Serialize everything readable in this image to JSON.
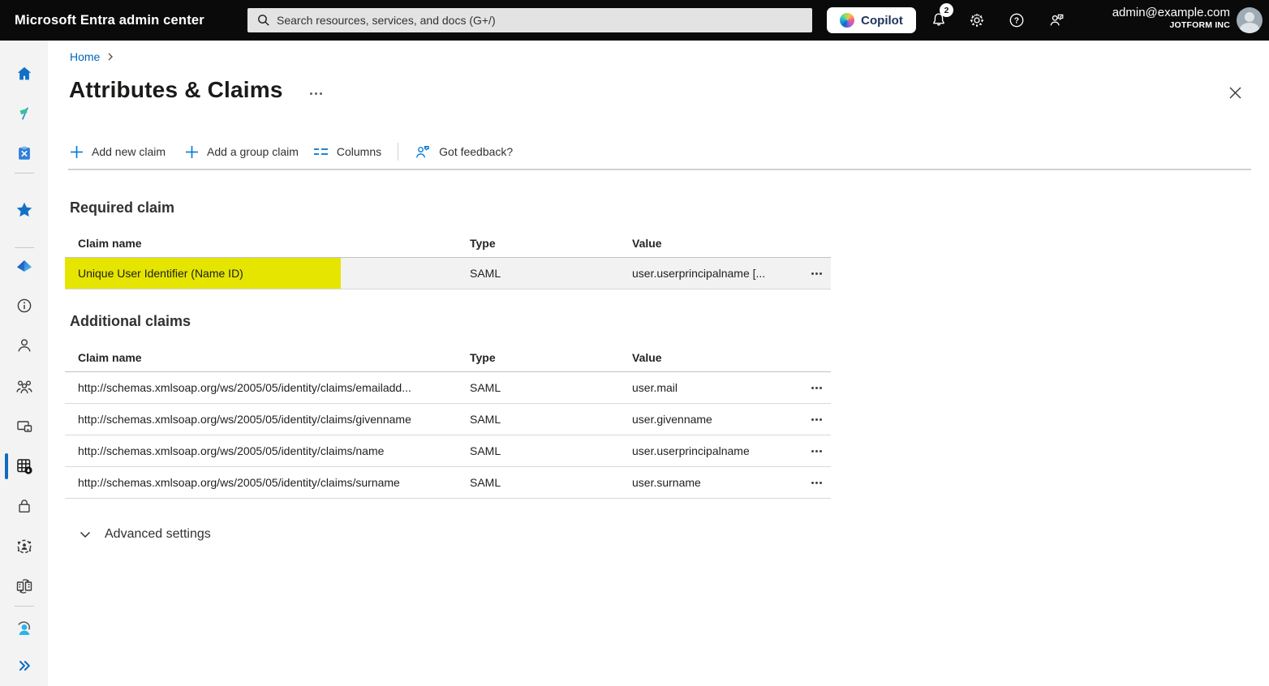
{
  "topbar": {
    "brand": "Microsoft Entra admin center",
    "search_placeholder": "Search resources, services, and docs (G+/)",
    "copilot_label": "Copilot",
    "notification_count": "2",
    "account_email": "admin@example.com",
    "account_org": "JOTFORM INC",
    "icons": [
      "bell-icon",
      "gear-icon",
      "help-icon",
      "feedback-icon",
      "avatar"
    ]
  },
  "sidebar": {
    "icons": [
      "home-icon",
      "whats-new-flag-icon",
      "diagnose-solve-icon",
      "favorites-star-icon",
      "entra-id-icon",
      "info-icon",
      "users-icon",
      "groups-icon",
      "devices-icon",
      "applications-grid-icon",
      "protection-lock-icon",
      "identity-governance-icon",
      "external-identities-icon",
      "learn-support-icon",
      "expand-chevrons-icon"
    ],
    "active_icon": "applications-grid-icon"
  },
  "breadcrumb": {
    "home": "Home"
  },
  "page": {
    "title": "Attributes & Claims"
  },
  "toolbar": {
    "add_new_claim": "Add new claim",
    "add_group_claim": "Add a group claim",
    "columns": "Columns",
    "got_feedback": "Got feedback?"
  },
  "required_claim": {
    "heading": "Required claim",
    "columns": {
      "claim_name": "Claim name",
      "type": "Type",
      "value": "Value"
    },
    "rows": [
      {
        "claim_name": "Unique User Identifier (Name ID)",
        "type": "SAML",
        "value": "user.userprincipalname [...",
        "highlighted": true
      }
    ]
  },
  "additional_claims": {
    "heading": "Additional claims",
    "columns": {
      "claim_name": "Claim name",
      "type": "Type",
      "value": "Value"
    },
    "rows": [
      {
        "claim_name": "http://schemas.xmlsoap.org/ws/2005/05/identity/claims/emailadd...",
        "type": "SAML",
        "value": "user.mail"
      },
      {
        "claim_name": "http://schemas.xmlsoap.org/ws/2005/05/identity/claims/givenname",
        "type": "SAML",
        "value": "user.givenname"
      },
      {
        "claim_name": "http://schemas.xmlsoap.org/ws/2005/05/identity/claims/name",
        "type": "SAML",
        "value": "user.userprincipalname"
      },
      {
        "claim_name": "http://schemas.xmlsoap.org/ws/2005/05/identity/claims/surname",
        "type": "SAML",
        "value": "user.surname"
      }
    ]
  },
  "advanced_settings": {
    "label": "Advanced settings"
  },
  "colors": {
    "accent": "#0078d4",
    "topbar_bg": "#0a0a0a",
    "highlight": "#e5e500",
    "row_bg": "#f2f2f2",
    "sidebar_bg": "#f3f3f3"
  }
}
